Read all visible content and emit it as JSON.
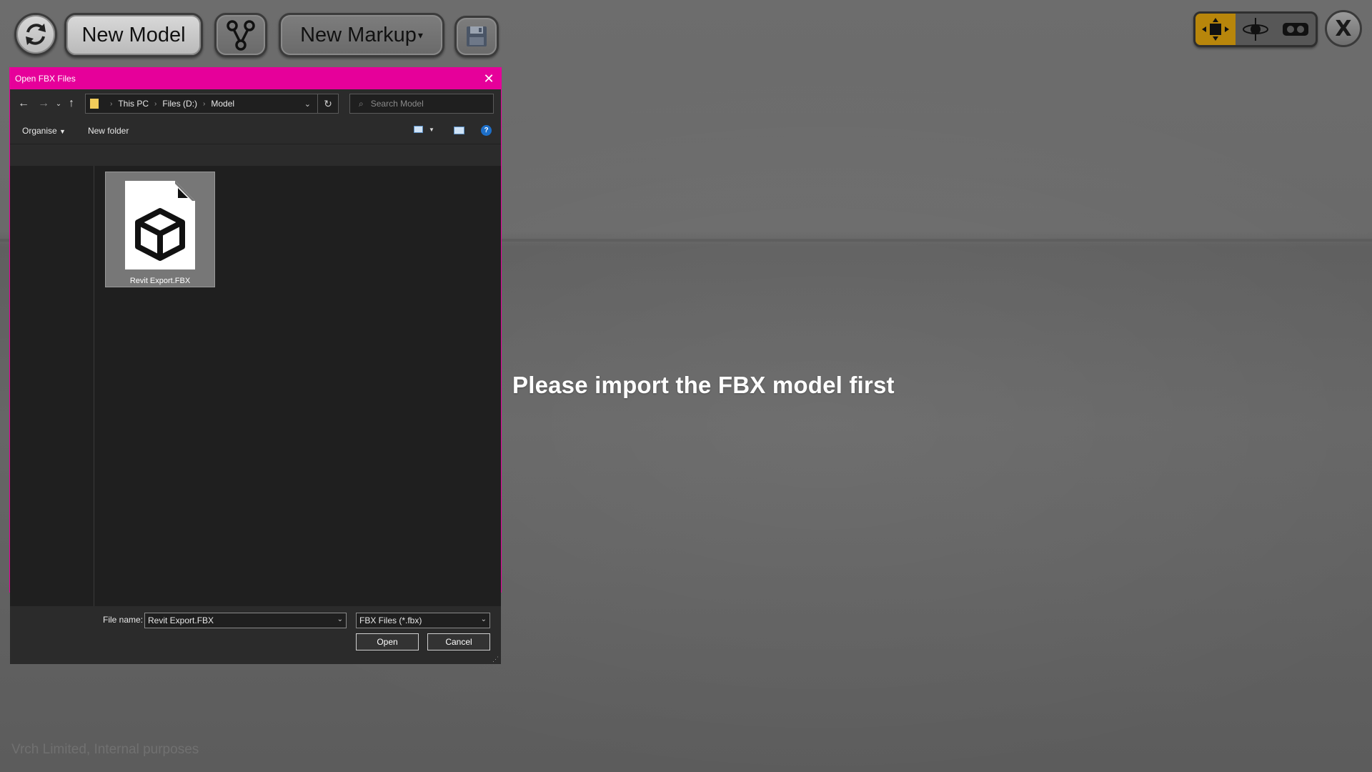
{
  "toolbar": {
    "new_model_label": "New Model",
    "new_markup_label": "New Markup",
    "new_markup_arrow": "▾",
    "close_label": "X"
  },
  "view_modes": [
    "move-mode-icon",
    "orbit-mode-icon",
    "vr-mode-icon"
  ],
  "colors": {
    "accent": "#e6009a",
    "active_view": "#b8860b"
  },
  "scene": {
    "message": "Please import the FBX model first",
    "watermark": "Vrch Limited, Internal purposes"
  },
  "dialog": {
    "title": "Open FBX Files",
    "breadcrumb": [
      "This PC",
      "Files (D:)",
      "Model"
    ],
    "search_placeholder": "Search Model",
    "organise_label": "Organise",
    "new_folder_label": "New folder",
    "files": [
      {
        "name": "Revit Export.FBX",
        "icon": "3d-model-file-icon",
        "selected": true
      }
    ],
    "file_name_label": "File name:",
    "file_name_value": "Revit Export.FBX",
    "file_type_value": "FBX Files (*.fbx)",
    "open_label": "Open",
    "cancel_label": "Cancel"
  }
}
